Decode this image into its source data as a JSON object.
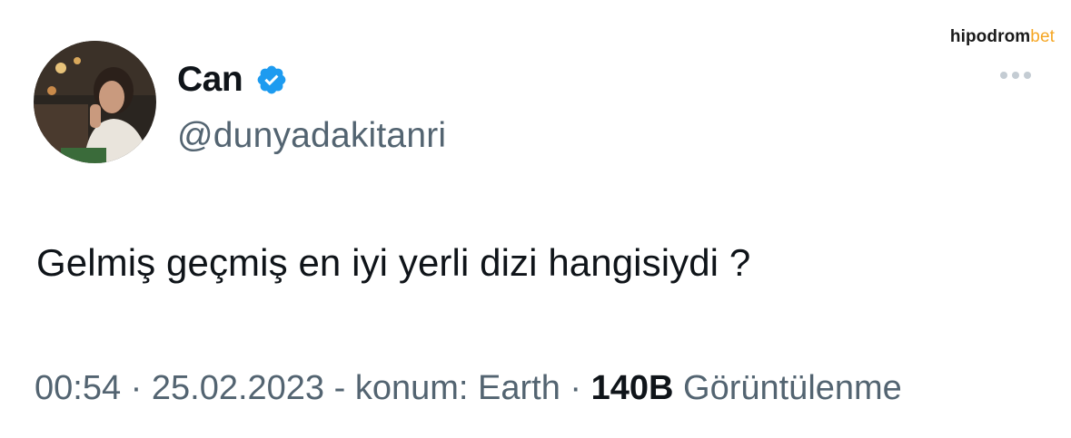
{
  "author": {
    "display_name": "Can",
    "handle": "@dunyadakitanri",
    "verified": true,
    "verified_color": "#1d9bf0",
    "avatar_icon": "avatar-photo"
  },
  "brand": {
    "part1": "hipodrom",
    "part2": "bet",
    "part2_color": "#f5a623"
  },
  "more_icon": "ellipsis-icon",
  "tweet": {
    "text": "Gelmiş geçmiş en iyi yerli dizi hangisiydi ?"
  },
  "meta": {
    "time": "00:54",
    "sep1": " · ",
    "date": "25.02.2023",
    "location": " - konum: Earth",
    "sep2": " · ",
    "views_count": "140B",
    "views_label": " Görüntülenme"
  }
}
